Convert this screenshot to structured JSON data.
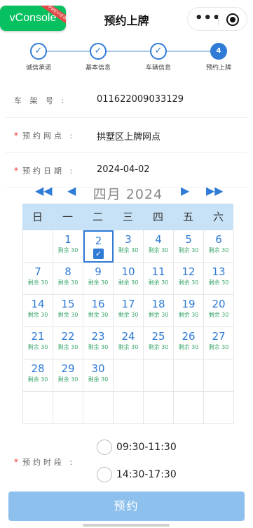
{
  "vconsole": {
    "label": "vConsole",
    "ribbon": "PREVIEW"
  },
  "header": {
    "title": "预约上牌",
    "more": "•••"
  },
  "steps": [
    {
      "label": "诚信承诺",
      "state": "done",
      "icon": "check-icon"
    },
    {
      "label": "基本信息",
      "state": "done",
      "icon": "check-icon"
    },
    {
      "label": "车辆信息",
      "state": "done",
      "icon": "check-icon"
    },
    {
      "label": "预约上牌",
      "state": "active",
      "number": "4"
    }
  ],
  "form": {
    "vin": {
      "label": "车 架 号 :",
      "value": "011622009033129"
    },
    "outlet": {
      "label": "预约网点 :",
      "value": "拱墅区上牌网点"
    },
    "date": {
      "label": "预约日期 :",
      "value": "2024-04-02"
    },
    "required_mark": "*"
  },
  "calendar": {
    "nav": {
      "prev_year": "◀◀",
      "prev_month": "◀",
      "next_month": "▶",
      "next_year": "▶▶"
    },
    "month_label": "四月",
    "year_label": "2024",
    "weekdays": [
      "日",
      "一",
      "二",
      "三",
      "四",
      "五",
      "六"
    ],
    "days": [
      {
        "day": "",
        "rem": ""
      },
      {
        "day": "1",
        "rem": "剩余 30"
      },
      {
        "day": "2",
        "rem": "",
        "selected": true
      },
      {
        "day": "3",
        "rem": "剩余 30"
      },
      {
        "day": "4",
        "rem": "剩余 30"
      },
      {
        "day": "5",
        "rem": "剩余 30"
      },
      {
        "day": "6",
        "rem": "剩余 30"
      },
      {
        "day": "7",
        "rem": "剩余 30"
      },
      {
        "day": "8",
        "rem": "剩余 30"
      },
      {
        "day": "9",
        "rem": "剩余 30"
      },
      {
        "day": "10",
        "rem": "剩余 30"
      },
      {
        "day": "11",
        "rem": "剩余 30"
      },
      {
        "day": "12",
        "rem": "剩余 30"
      },
      {
        "day": "13",
        "rem": "剩余 30"
      },
      {
        "day": "14",
        "rem": "剩余 30"
      },
      {
        "day": "15",
        "rem": "剩余 30"
      },
      {
        "day": "16",
        "rem": "剩余 30"
      },
      {
        "day": "17",
        "rem": "剩余 30"
      },
      {
        "day": "18",
        "rem": "剩余 30"
      },
      {
        "day": "19",
        "rem": "剩余 30"
      },
      {
        "day": "20",
        "rem": "剩余 30"
      },
      {
        "day": "21",
        "rem": "剩余 30"
      },
      {
        "day": "22",
        "rem": "剩余 30"
      },
      {
        "day": "23",
        "rem": "剩余 30"
      },
      {
        "day": "24",
        "rem": "剩余 30"
      },
      {
        "day": "25",
        "rem": "剩余 30"
      },
      {
        "day": "26",
        "rem": "剩余 30"
      },
      {
        "day": "27",
        "rem": "剩余 30"
      },
      {
        "day": "28",
        "rem": "剩余 30"
      },
      {
        "day": "29",
        "rem": "剩余 30"
      },
      {
        "day": "30",
        "rem": "剩余 30"
      },
      {
        "day": "",
        "rem": ""
      },
      {
        "day": "",
        "rem": ""
      },
      {
        "day": "",
        "rem": ""
      },
      {
        "day": "",
        "rem": ""
      },
      {
        "day": "",
        "rem": ""
      },
      {
        "day": "",
        "rem": ""
      },
      {
        "day": "",
        "rem": ""
      },
      {
        "day": "",
        "rem": ""
      },
      {
        "day": "",
        "rem": ""
      },
      {
        "day": "",
        "rem": ""
      },
      {
        "day": "",
        "rem": ""
      }
    ]
  },
  "timeslot": {
    "label": "预约时段 :",
    "options": [
      "09:30-11:30",
      "14:30-17:30"
    ]
  },
  "submit_label": "预约",
  "colors": {
    "accent": "#2f7bd6",
    "weekday_bg": "#c7e2f7",
    "remaining": "#3aa66b",
    "required": "#e33333",
    "button": "#8ec0ee",
    "vconsole": "#07c160"
  }
}
